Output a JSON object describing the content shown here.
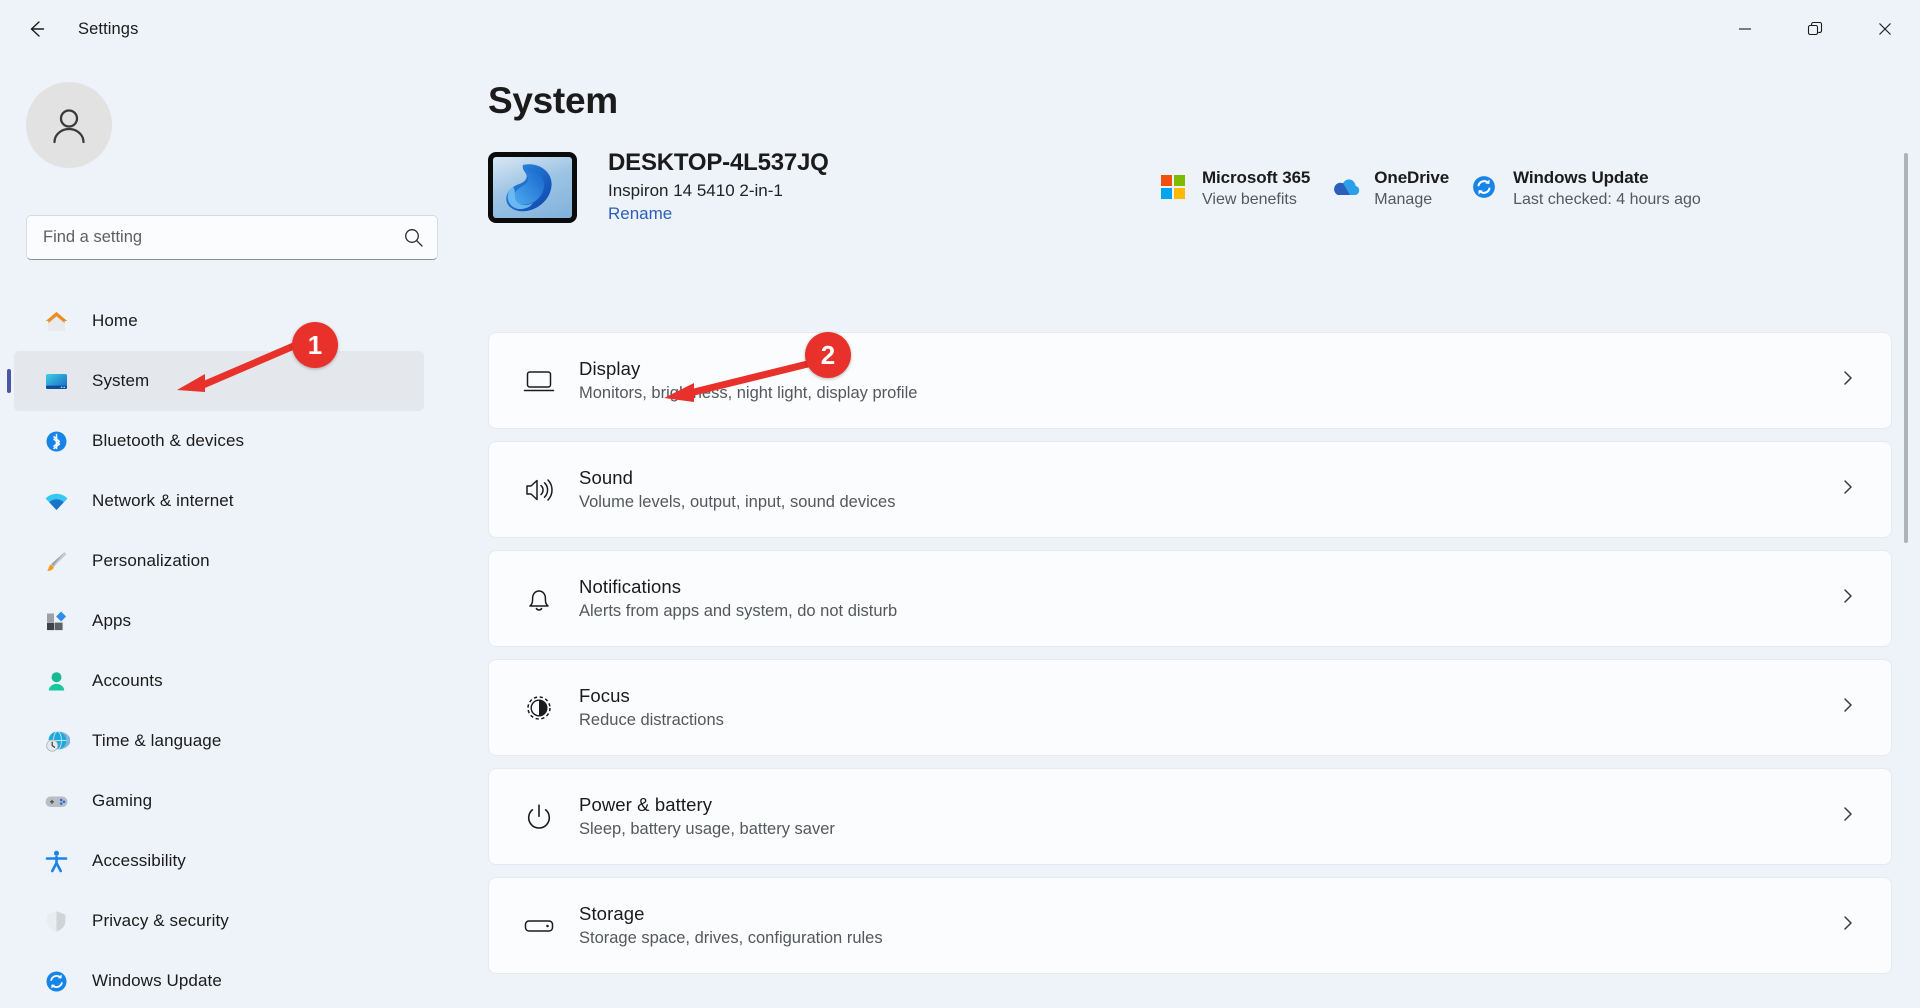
{
  "window": {
    "app_title": "Settings",
    "back_label": "Back",
    "controls": {
      "minimize": "Minimize",
      "maximize": "Restore",
      "close": "Close"
    }
  },
  "sidebar": {
    "account_avatar": "account-avatar",
    "search": {
      "placeholder": "Find a setting",
      "value": ""
    },
    "items": [
      {
        "label": "Home",
        "icon": "home-icon",
        "selected": false
      },
      {
        "label": "System",
        "icon": "system-icon",
        "selected": true
      },
      {
        "label": "Bluetooth & devices",
        "icon": "bluetooth-icon",
        "selected": false
      },
      {
        "label": "Network & internet",
        "icon": "network-icon",
        "selected": false
      },
      {
        "label": "Personalization",
        "icon": "personalization-icon",
        "selected": false
      },
      {
        "label": "Apps",
        "icon": "apps-icon",
        "selected": false
      },
      {
        "label": "Accounts",
        "icon": "accounts-icon",
        "selected": false
      },
      {
        "label": "Time & language",
        "icon": "time-language-icon",
        "selected": false
      },
      {
        "label": "Gaming",
        "icon": "gaming-icon",
        "selected": false
      },
      {
        "label": "Accessibility",
        "icon": "accessibility-icon",
        "selected": false
      },
      {
        "label": "Privacy & security",
        "icon": "privacy-security-icon",
        "selected": false
      },
      {
        "label": "Windows Update",
        "icon": "windows-update-icon",
        "selected": false
      }
    ]
  },
  "main": {
    "page_title": "System",
    "device": {
      "name": "DESKTOP-4L537JQ",
      "model": "Inspiron 14 5410 2-in-1",
      "rename_label": "Rename"
    },
    "quick_links": [
      {
        "title": "Microsoft 365",
        "subtitle": "View benefits",
        "icon": "microsoft-365-icon"
      },
      {
        "title": "OneDrive",
        "subtitle": "Manage",
        "icon": "onedrive-icon"
      },
      {
        "title": "Windows Update",
        "subtitle": "Last checked: 4 hours ago",
        "icon": "windows-update-icon"
      }
    ],
    "settings_rows": [
      {
        "title": "Display",
        "subtitle": "Monitors, brightness, night light, display profile",
        "icon": "display-icon"
      },
      {
        "title": "Sound",
        "subtitle": "Volume levels, output, input, sound devices",
        "icon": "sound-icon"
      },
      {
        "title": "Notifications",
        "subtitle": "Alerts from apps and system, do not disturb",
        "icon": "notifications-icon"
      },
      {
        "title": "Focus",
        "subtitle": "Reduce distractions",
        "icon": "focus-icon"
      },
      {
        "title": "Power & battery",
        "subtitle": "Sleep, battery usage, battery saver",
        "icon": "power-battery-icon"
      },
      {
        "title": "Storage",
        "subtitle": "Storage space, drives, configuration rules",
        "icon": "storage-icon"
      }
    ]
  },
  "annotations": {
    "color": "#e8312a",
    "steps": [
      {
        "number": "1",
        "target": "System sidebar item"
      },
      {
        "number": "2",
        "target": "Display settings row"
      }
    ]
  }
}
